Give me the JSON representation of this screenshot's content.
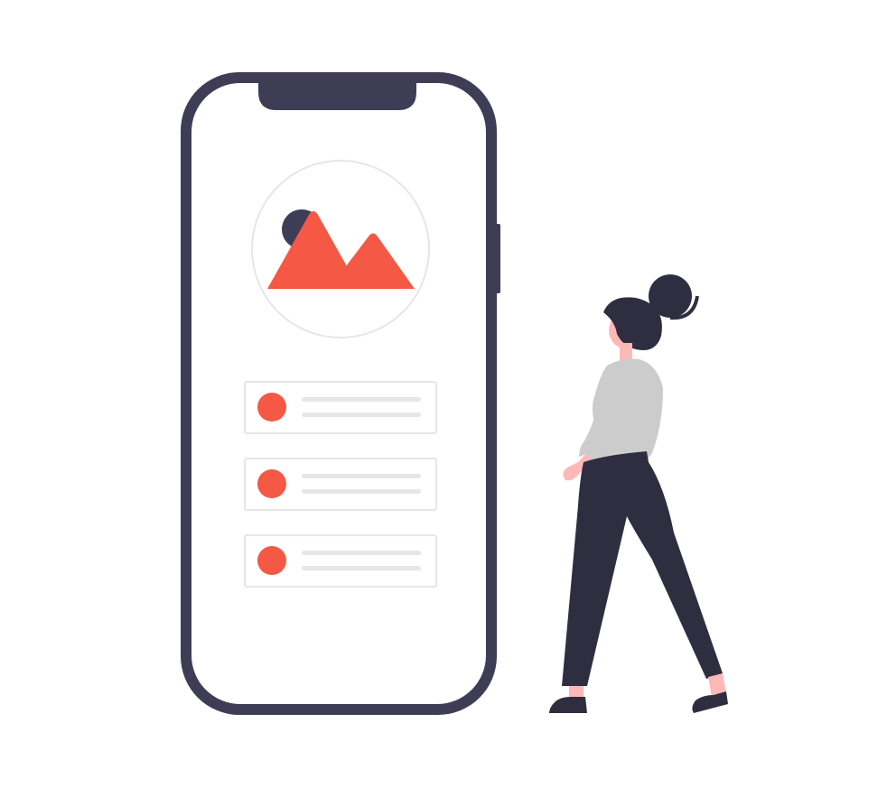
{
  "illustration": {
    "phone": {
      "screen_image_icon": "image-placeholder-icon",
      "list_items_count": 3
    },
    "person": {
      "pose": "standing-looking-at-phone"
    }
  },
  "colors": {
    "phone_frame": "#3f3d56",
    "phone_screen": "#ffffff",
    "notch": "#3f3d56",
    "accent": "#f55845",
    "sun": "#3f3d56",
    "placeholder_line": "#e6e6e6",
    "card_border": "#e6e6e6",
    "circle_border": "#e6e6e6",
    "hair_pants_shoes": "#2f2e41",
    "shirt": "#cccccc",
    "skin": "#ffb8b8"
  }
}
